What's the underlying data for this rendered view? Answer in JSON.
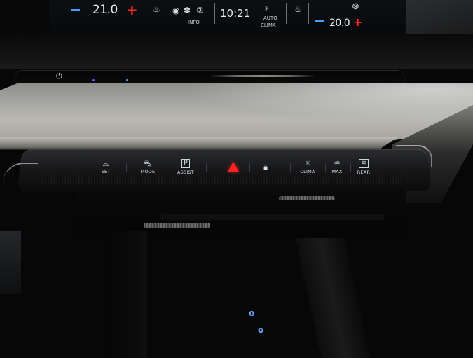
{
  "screen": {
    "left_temp": "21.0",
    "time": "10:21",
    "info_label": "INFO",
    "auto_label": "AUTO",
    "clima_label": "CLIMA",
    "right_temp": "20.0",
    "plus_symbol": "+",
    "minus_symbol": "−"
  },
  "control_panel": {
    "buttons": [
      {
        "label": "SET",
        "icon": "car-icon"
      },
      {
        "label": "MODE",
        "icon": "car-front-icon"
      },
      {
        "label": "ASSIST",
        "icon": "parking-icon"
      },
      {
        "label": "",
        "icon": "hazard-icon"
      },
      {
        "label": "",
        "icon": "lock-icon"
      },
      {
        "label": "CLIMA",
        "icon": "sun-icon"
      },
      {
        "label": "MAX",
        "icon": "defrost-front-icon"
      },
      {
        "label": "REAR",
        "icon": "defrost-rear-icon"
      }
    ]
  },
  "colors": {
    "hazard": "#ff2020",
    "temp_minus": "#3fa0ff",
    "temp_plus": "#ff2a2a",
    "ambient_blue": "#6fa8ff"
  }
}
